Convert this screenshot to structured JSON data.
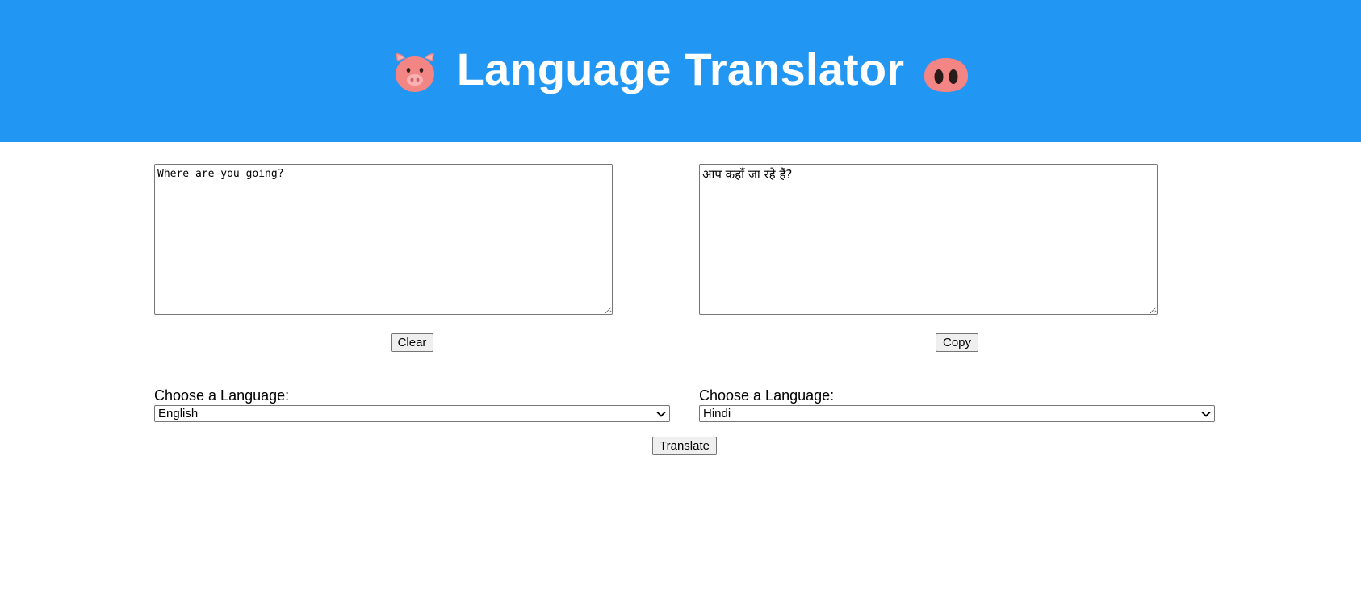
{
  "header": {
    "title": "Language Translator",
    "left_icon": "pig-face-icon",
    "right_icon": "pig-nose-icon",
    "background": "#2196f3"
  },
  "source": {
    "text": "Where are you going?",
    "clear_label": "Clear",
    "language_label": "Choose a Language:",
    "language_selected": "English"
  },
  "target": {
    "text": "आप कहाँ जा रहे हैं?",
    "copy_label": "Copy",
    "language_label": "Choose a Language:",
    "language_selected": "Hindi"
  },
  "actions": {
    "translate_label": "Translate"
  }
}
